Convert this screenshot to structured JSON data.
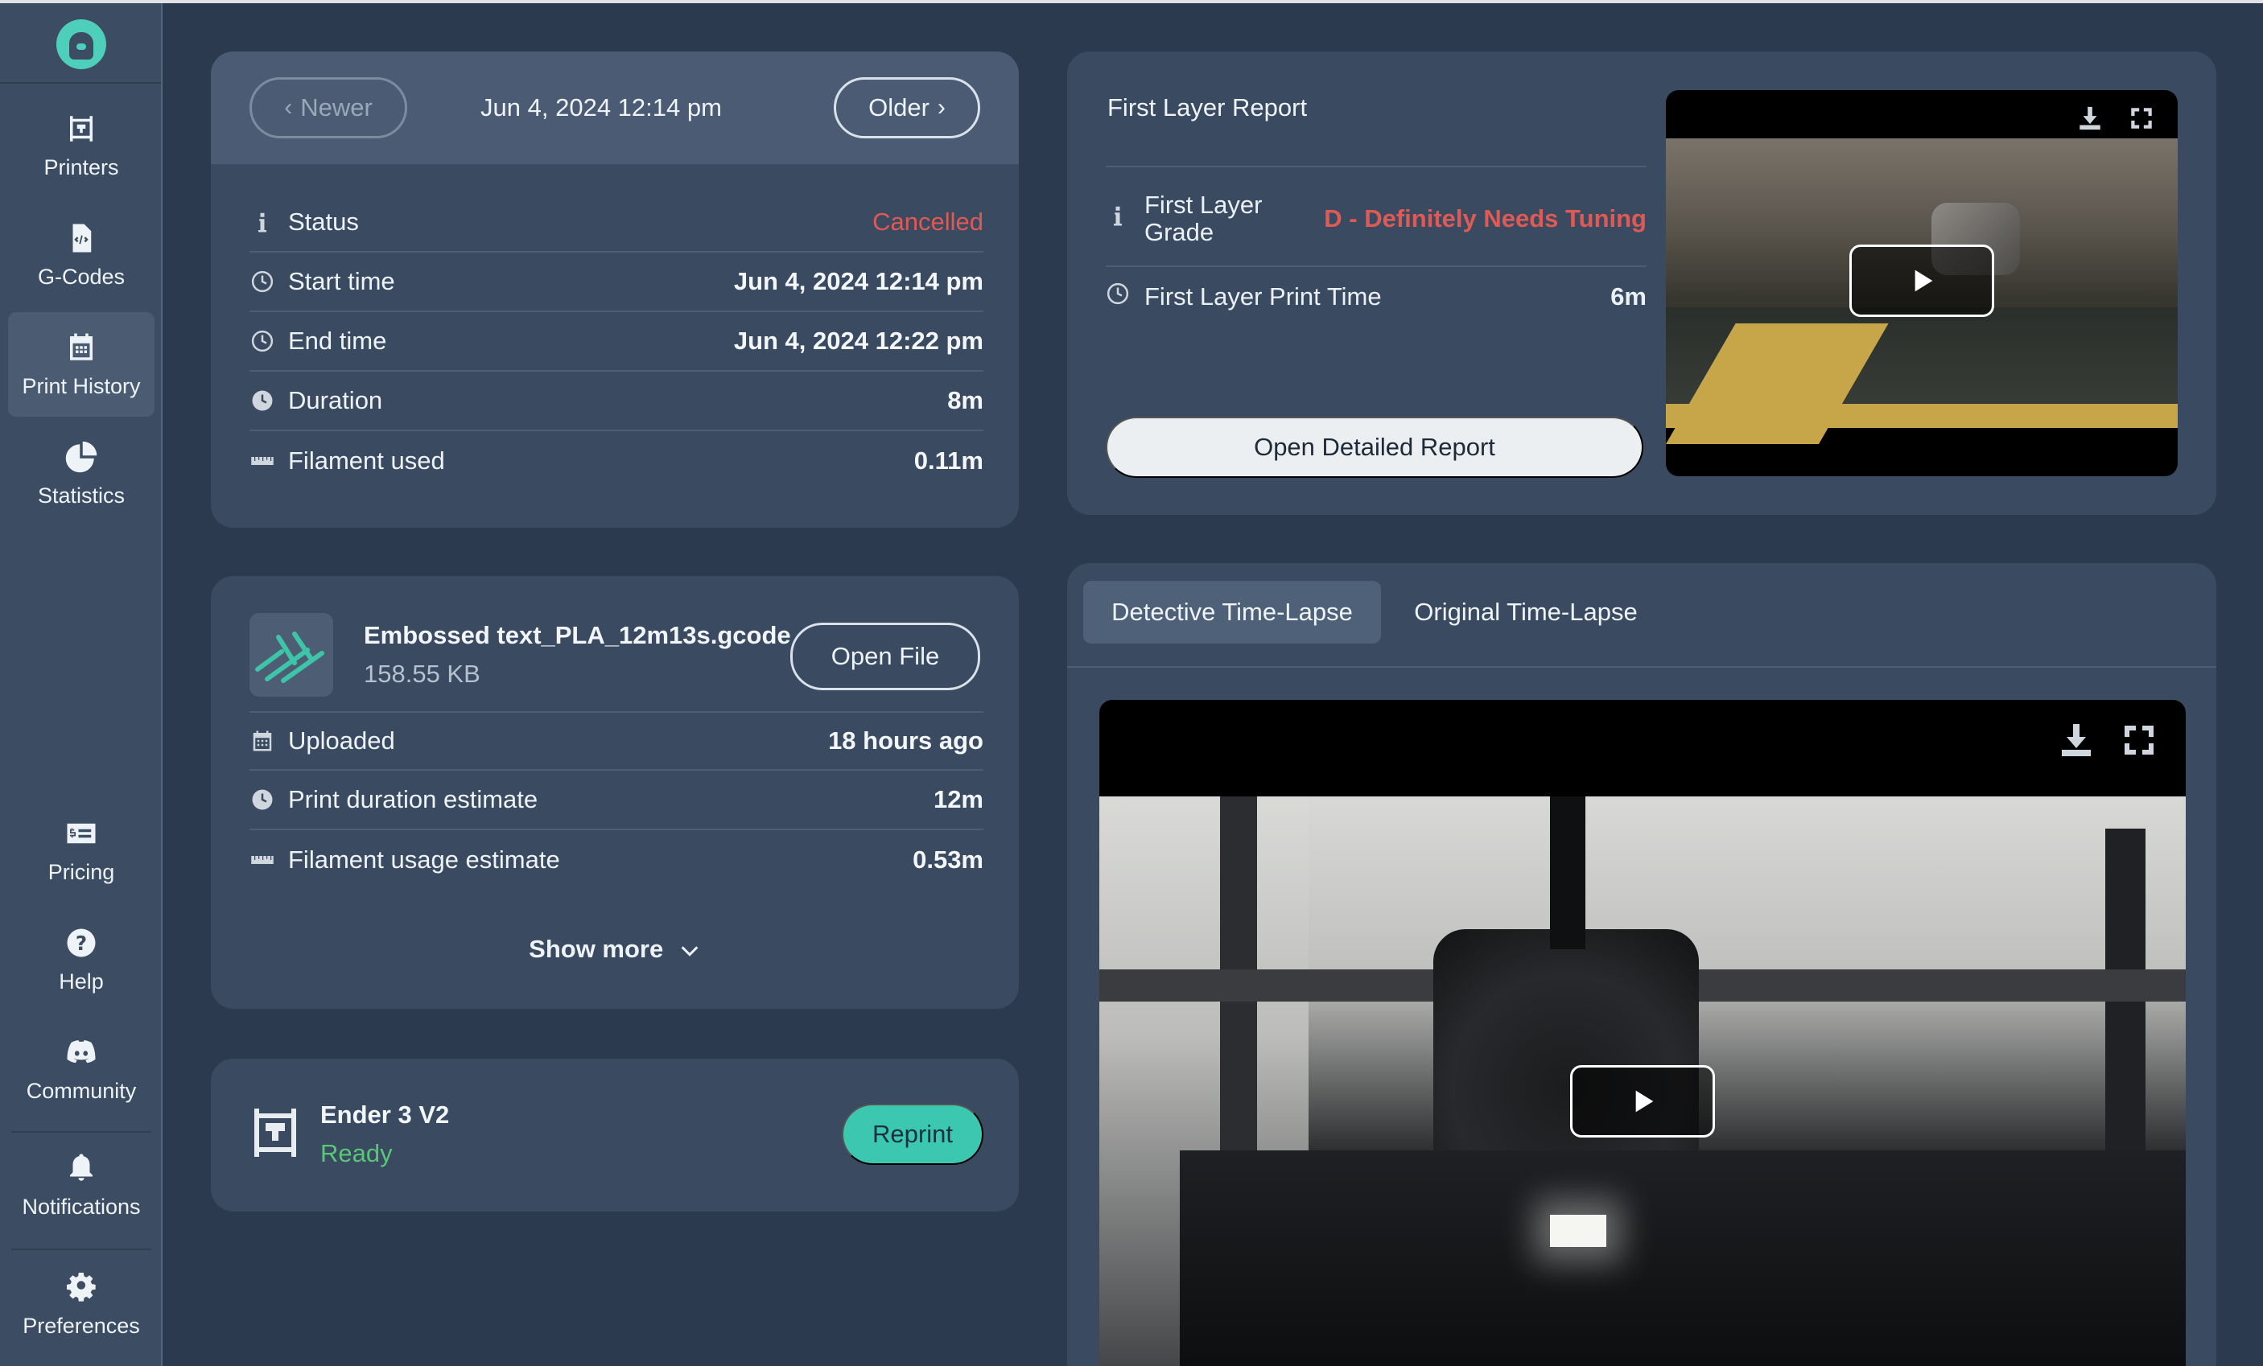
{
  "sidebar": {
    "items": [
      {
        "label": "Printers",
        "icon": "printer-icon"
      },
      {
        "label": "G-Codes",
        "icon": "gcode-file-icon"
      },
      {
        "label": "Print History",
        "icon": "calendar-icon"
      },
      {
        "label": "Statistics",
        "icon": "pie-chart-icon"
      },
      {
        "label": "Pricing",
        "icon": "pricing-icon"
      },
      {
        "label": "Help",
        "icon": "help-icon"
      },
      {
        "label": "Community",
        "icon": "discord-icon"
      },
      {
        "label": "Notifications",
        "icon": "bell-icon"
      },
      {
        "label": "Preferences",
        "icon": "gear-icon"
      }
    ],
    "active": "Print History"
  },
  "print": {
    "newer_label": "Newer",
    "older_label": "Older",
    "date": "Jun 4, 2024 12:14 pm",
    "rows": [
      {
        "label": "Status",
        "value": "Cancelled"
      },
      {
        "label": "Start time",
        "value": "Jun 4, 2024 12:14 pm"
      },
      {
        "label": "End time",
        "value": "Jun 4, 2024 12:22 pm"
      },
      {
        "label": "Duration",
        "value": "8m"
      },
      {
        "label": "Filament used",
        "value": "0.11m"
      }
    ]
  },
  "file": {
    "name": "Embossed text_PLA_12m13s.gcode",
    "size": "158.55 KB",
    "open_label": "Open File",
    "rows": [
      {
        "label": "Uploaded",
        "value": "18 hours ago"
      },
      {
        "label": "Print duration estimate",
        "value": "12m"
      },
      {
        "label": "Filament usage estimate",
        "value": "0.53m"
      }
    ],
    "show_more": "Show more"
  },
  "printer": {
    "name": "Ender 3 V2",
    "status": "Ready",
    "reprint_label": "Reprint"
  },
  "first_layer": {
    "title": "First Layer Report",
    "grade_label_1": "First Layer",
    "grade_label_2": "Grade",
    "grade_value": "D - Definitely Needs Tuning",
    "time_label": "First Layer Print Time",
    "time_value": "6m",
    "button": "Open Detailed Report"
  },
  "timelapse": {
    "tabs": [
      "Detective Time-Lapse",
      "Original Time-Lapse"
    ],
    "active_tab": "Detective Time-Lapse"
  },
  "colors": {
    "background": "#2b3a4e",
    "card": "#3a4a60",
    "accent": "#3cc8b0",
    "danger": "#e05a55",
    "ready": "#59c778"
  }
}
